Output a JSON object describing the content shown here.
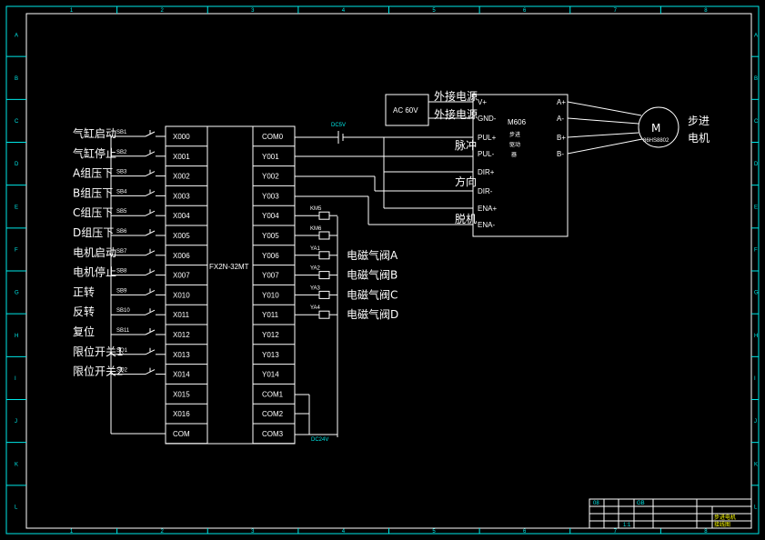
{
  "border": {
    "col_numbers": [
      "1",
      "2",
      "3",
      "4",
      "5",
      "6",
      "7",
      "8"
    ],
    "row_letters": [
      "A",
      "B",
      "C",
      "D",
      "E",
      "F",
      "G",
      "H",
      "I",
      "J",
      "K",
      "L"
    ]
  },
  "plc": {
    "model": "FX2N-32MT",
    "inputs": [
      "X000",
      "X001",
      "X002",
      "X003",
      "X004",
      "X005",
      "X006",
      "X007",
      "X010",
      "X011",
      "X012",
      "X013",
      "X014",
      "X015",
      "X016",
      "COM"
    ],
    "outputs": [
      "COM0",
      "Y001",
      "Y002",
      "Y003",
      "Y004",
      "Y005",
      "Y006",
      "Y007",
      "Y010",
      "Y011",
      "Y012",
      "Y013",
      "Y014",
      "COM1",
      "COM2",
      "COM3"
    ]
  },
  "input_devices": [
    {
      "tag": "SB1",
      "label": "气缸启动"
    },
    {
      "tag": "SB2",
      "label": "气缸停止"
    },
    {
      "tag": "SB3",
      "label": "A组压下"
    },
    {
      "tag": "SB4",
      "label": "B组压下"
    },
    {
      "tag": "SB5",
      "label": "C组压下"
    },
    {
      "tag": "SB6",
      "label": "D组压下"
    },
    {
      "tag": "SB7",
      "label": "电机启动"
    },
    {
      "tag": "SB8",
      "label": "电机停止"
    },
    {
      "tag": "SB9",
      "label": "正转"
    },
    {
      "tag": "SB10",
      "label": "反转"
    },
    {
      "tag": "SB11",
      "label": "复位"
    },
    {
      "tag": "SQ1",
      "label": "限位开关1"
    },
    {
      "tag": "SQ2",
      "label": "限位开关2"
    }
  ],
  "outputs_loads": [
    {
      "tag": "KM5",
      "label": ""
    },
    {
      "tag": "KM6",
      "label": ""
    },
    {
      "tag": "YA1",
      "label": "电磁气阀A"
    },
    {
      "tag": "YA2",
      "label": "电磁气阀B"
    },
    {
      "tag": "YA3",
      "label": "电磁气阀C"
    },
    {
      "tag": "YA4",
      "label": "电磁气阀D"
    }
  ],
  "dc_source_top": "DC5V",
  "dc_source_bottom": "DC24V",
  "power": {
    "label": "AC 60V",
    "ext1": "外接电源",
    "ext2": "外接电源"
  },
  "driver": {
    "model": "M606",
    "line2": "步进",
    "line3": "驱动",
    "line4": "器",
    "pins_left": [
      "V+",
      "GND-",
      "PUL+",
      "PUL-",
      "DIR+",
      "DIR-",
      "ENA+",
      "ENA-"
    ],
    "pins_right": [
      "A+",
      "A-",
      "B+",
      "B-"
    ]
  },
  "signals": {
    "pulse": "脉冲",
    "direction": "方向",
    "enable": "脱机"
  },
  "motor": {
    "symbol": "M",
    "model": "86HS8802",
    "label1": "步进",
    "label2": "电机"
  },
  "title_block": {
    "cell_left": "08",
    "cell_mid": "GB",
    "cell_small": "1:1",
    "right1": "步进电机",
    "right2": "接线图"
  }
}
